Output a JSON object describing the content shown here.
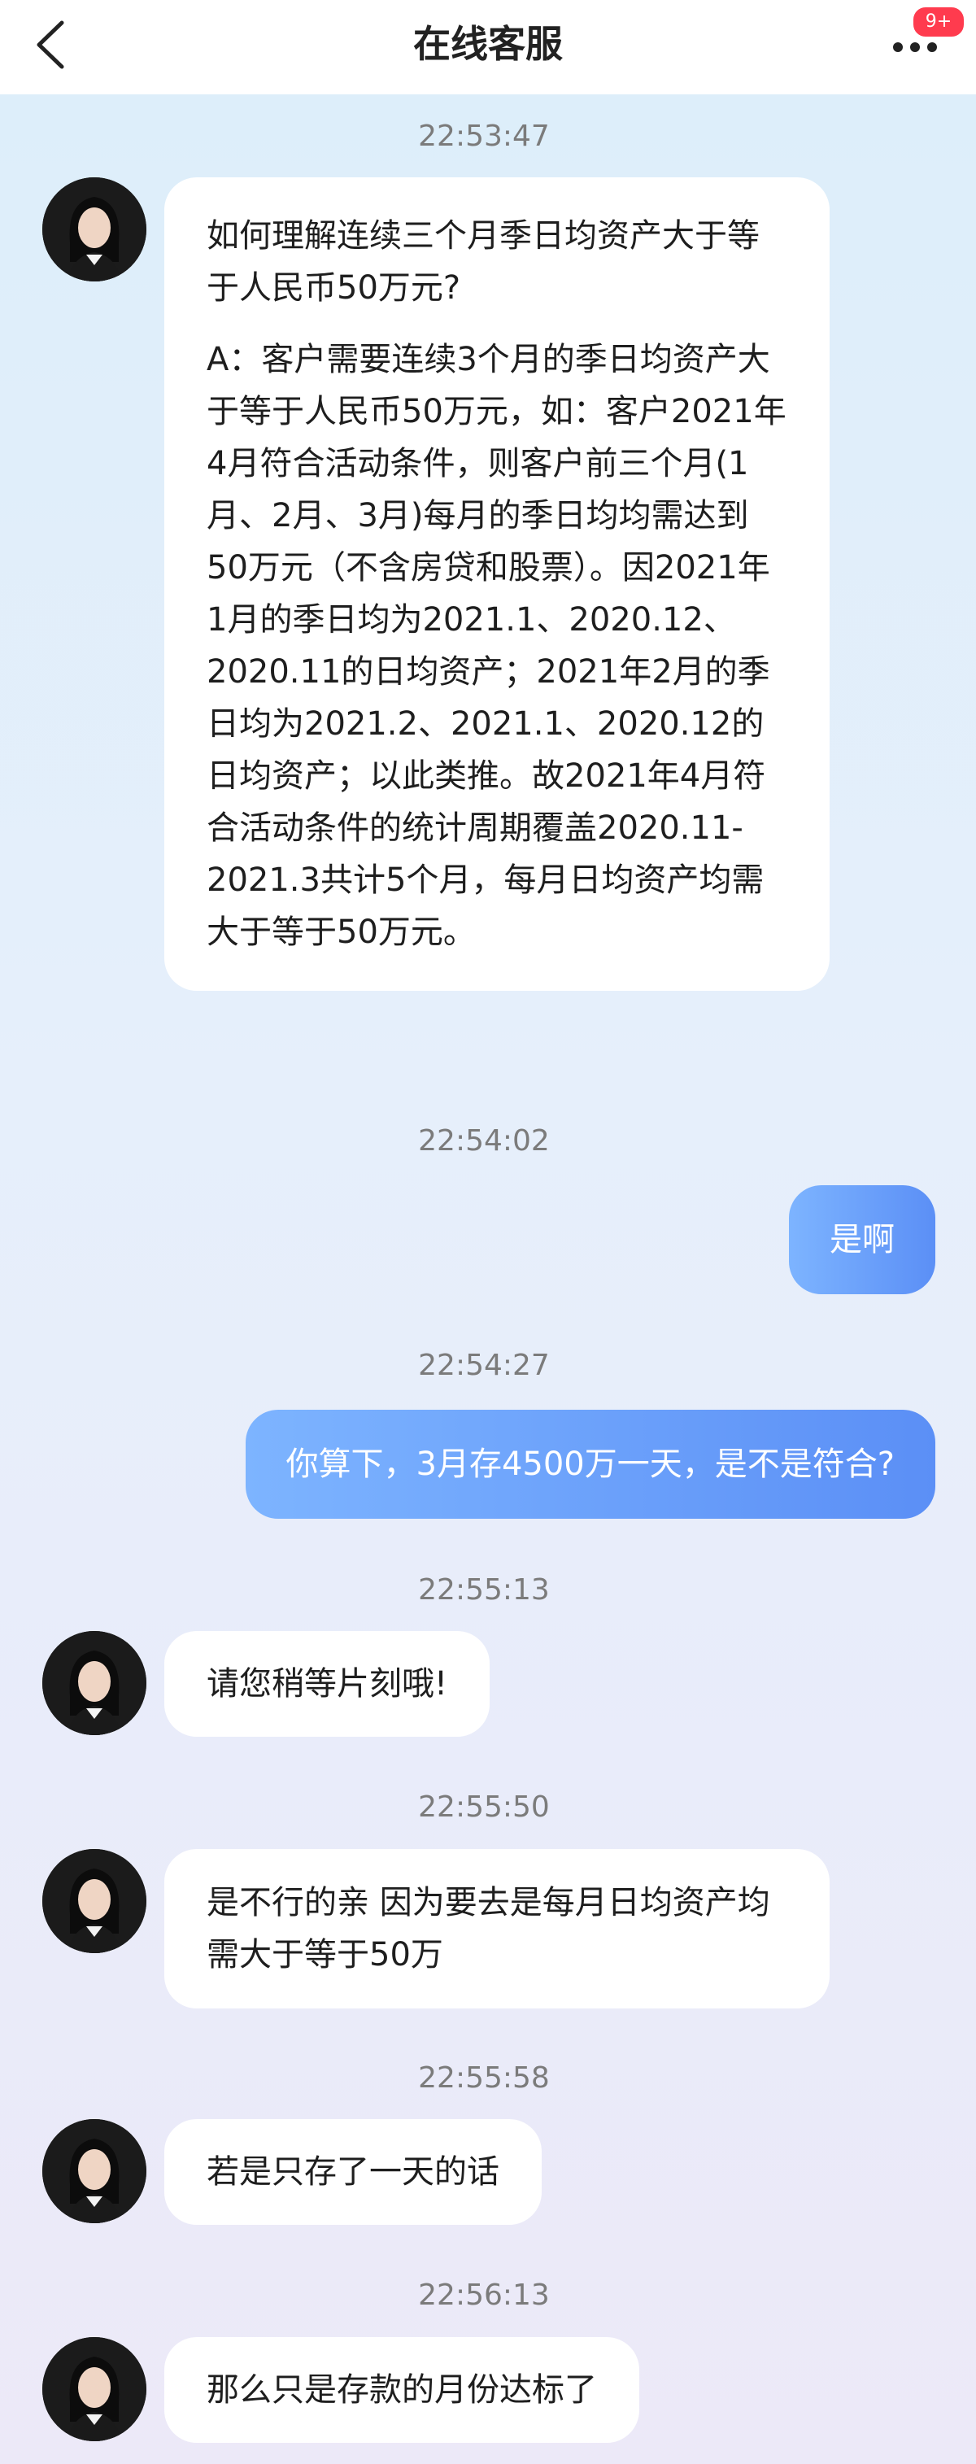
{
  "header": {
    "title": "在线客服",
    "back_icon": "chevron-left-icon",
    "more_icon": "more-dots-icon",
    "badge": "9+",
    "badge_color": "#ff3b4e"
  },
  "messages": [
    {
      "time": "22:53:47"
    },
    {
      "from": "agent",
      "paragraphs": [
        "如何理解连续三个月季日均资产大于等于人民币50万元?",
        "A：客户需要连续3个月的季日均资产大于等于人民币50万元，如：客户2021年4月符合活动条件，则客户前三个月(1月、2月、3月)每月的季日均均需达到50万元（不含房贷和股票）。因2021年1月的季日均为2021.1、2020.12、2020.11的日均资产；2021年2月的季日均为2021.2、2021.1、2020.12的日均资产；以此类推。故2021年4月符合活动条件的统计周期覆盖2020.11-2021.3共计5个月，每月日均资产均需大于等于50万元。"
      ]
    },
    {
      "time": "22:54:02"
    },
    {
      "from": "user",
      "text": "是啊"
    },
    {
      "time": "22:54:27"
    },
    {
      "from": "user",
      "text": "你算下，3月存4500万一天，是不是符合?"
    },
    {
      "time": "22:55:13"
    },
    {
      "from": "agent",
      "paragraphs": [
        "请您稍等片刻哦!"
      ]
    },
    {
      "time": "22:55:50"
    },
    {
      "from": "agent",
      "paragraphs": [
        "是不行的亲 因为要去是每月日均资产均需大于等于50万"
      ]
    },
    {
      "time": "22:55:58"
    },
    {
      "from": "agent",
      "paragraphs": [
        "若是只存了一天的话"
      ]
    },
    {
      "time": "22:56:13"
    },
    {
      "from": "agent",
      "paragraphs": [
        "那么只是存款的月份达标了"
      ]
    }
  ],
  "colors": {
    "user_bubble_start": "#7db4ff",
    "user_bubble_end": "#5b8ff6",
    "agent_bubble": "#ffffff"
  }
}
